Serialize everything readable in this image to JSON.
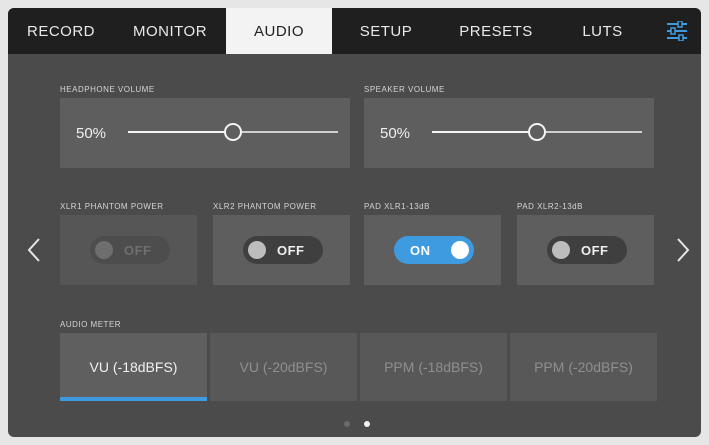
{
  "tabs": [
    {
      "label": "RECORD",
      "active": false
    },
    {
      "label": "MONITOR",
      "active": false
    },
    {
      "label": "AUDIO",
      "active": true
    },
    {
      "label": "SETUP",
      "active": false
    },
    {
      "label": "PRESETS",
      "active": false
    },
    {
      "label": "LUTS",
      "active": false
    }
  ],
  "settings_icon": "sliders-icon",
  "volume": {
    "headphone": {
      "label": "HEADPHONE VOLUME",
      "value_text": "50%",
      "value": 0.5
    },
    "speaker": {
      "label": "SPEAKER VOLUME",
      "value_text": "50%",
      "value": 0.5
    }
  },
  "toggles": [
    {
      "label": "XLR1 PHANTOM POWER",
      "state": "OFF",
      "enabled": false
    },
    {
      "label": "XLR2 PHANTOM POWER",
      "state": "OFF",
      "enabled": true
    },
    {
      "label": "PAD XLR1-13dB",
      "state": "ON",
      "enabled": true
    },
    {
      "label": "PAD XLR2-13dB",
      "state": "OFF",
      "enabled": true
    }
  ],
  "audio_meter": {
    "label": "AUDIO METER",
    "options": [
      "VU (-18dBFS)",
      "VU (-20dBFS)",
      "PPM (-18dBFS)",
      "PPM (-20dBFS)"
    ],
    "selected_index": 0
  },
  "navigation": {
    "prev_icon": "chevron-left-icon",
    "next_icon": "chevron-right-icon"
  },
  "pagination": {
    "pages": 2,
    "current": 2
  },
  "colors": {
    "accent": "#3e9be0",
    "panel": "#5e5e5e",
    "background": "#4b4b4b",
    "tabbar": "#1f1f1f"
  }
}
